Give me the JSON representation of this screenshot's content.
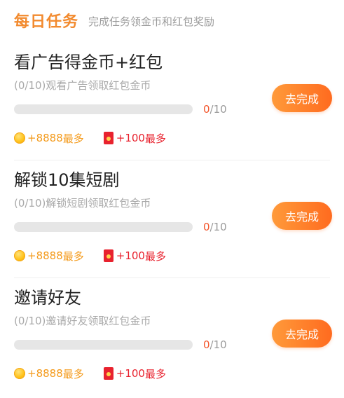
{
  "header": {
    "title": "每日任务",
    "subtitle": "完成任务领金币和红包奖励"
  },
  "tasks": [
    {
      "title": "看广告得金币+红包",
      "description": "(0/10)观看广告领取红包金币",
      "progress_done": "0",
      "progress_total": "/10",
      "progress_fraction": 0,
      "button_label": "去完成",
      "coin_reward": "+8888",
      "coin_suffix": "最多",
      "packet_reward": "+100",
      "packet_suffix": "最多"
    },
    {
      "title": "解锁10集短剧",
      "description": "(0/10)解锁短剧领取红包金币",
      "progress_done": "0",
      "progress_total": "/10",
      "progress_fraction": 0,
      "button_label": "去完成",
      "coin_reward": "+8888",
      "coin_suffix": "最多",
      "packet_reward": "+100",
      "packet_suffix": "最多"
    },
    {
      "title": "邀请好友",
      "description": "(0/10)邀请好友领取红包金币",
      "progress_done": "0",
      "progress_total": "/10",
      "progress_fraction": 0,
      "button_label": "去完成",
      "coin_reward": "+8888",
      "coin_suffix": "最多",
      "packet_reward": "+100",
      "packet_suffix": "最多"
    }
  ],
  "icons": {
    "coin": "coin-icon",
    "packet": "red-packet-icon"
  },
  "colors": {
    "accent": "#f28a2e",
    "button": "#ff7a25",
    "progress_done": "#f3542a",
    "coin": "#f49a1a",
    "packet": "#e8222e"
  }
}
